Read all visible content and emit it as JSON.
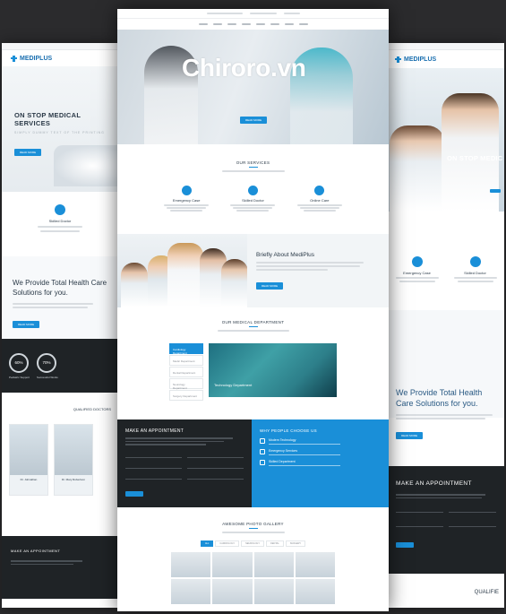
{
  "watermark": "Chiroro.vn",
  "brand": {
    "name": "MEDIPLUS"
  },
  "left": {
    "hero_title": "ON STOP MEDICAL SERVICES",
    "hero_sub": "SIMPLY DUMMY TEXT OF THE PRINTING",
    "feature_title": "Skilled Doctor",
    "provide_title": "We Provide Total Health Care Solutions for you.",
    "stats": [
      "60%",
      "70%"
    ],
    "stat_labels": [
      "Pediatric Support",
      "Successful Works"
    ],
    "doctors_title": "QUALIFIED DOCTORS",
    "doctor_names": [
      "Dr. Johnathan",
      "Dr. Mary Robertson"
    ],
    "appointment_title": "MAKE AN APPOINTMENT"
  },
  "center": {
    "services_title": "OUR SERVICES",
    "services": [
      "Emergency Case",
      "Skilled Doctor",
      "Online Care"
    ],
    "about_title": "Briefly About MediPlus",
    "department_title": "OUR MEDICAL DEPARTMENT",
    "department_tabs": [
      "Cardiology Department",
      "Medic Department",
      "Dental Department",
      "Neurology Department",
      "Surgery Department"
    ],
    "department_caption": "Technology Department",
    "appointment_title": "MAKE AN APPOINTMENT",
    "why_title": "WHY PEOPLE CHOOSE US",
    "why_items": [
      "Modern Technology",
      "Emergency Services",
      "Skilled Department"
    ],
    "gallery_title": "AWESOME PHOTO GALLERY",
    "gallery_filters": [
      "ALL",
      "CARDIOLOGY",
      "NEUROLOGY",
      "DENTAL",
      "SURGERY"
    ],
    "button_label": "READ MORE"
  },
  "right": {
    "hero_title": "ON STOP MEDIC",
    "features": [
      "Emergency Case",
      "Skilled Doctor"
    ],
    "provide_title": "We Provide Total Health Care Solutions for you.",
    "appointment_title": "MAKE AN APPOINTMENT",
    "footer_heading": "QUALIFIE"
  },
  "colors": {
    "accent": "#1a8fd8",
    "dark": "#1f2326"
  }
}
